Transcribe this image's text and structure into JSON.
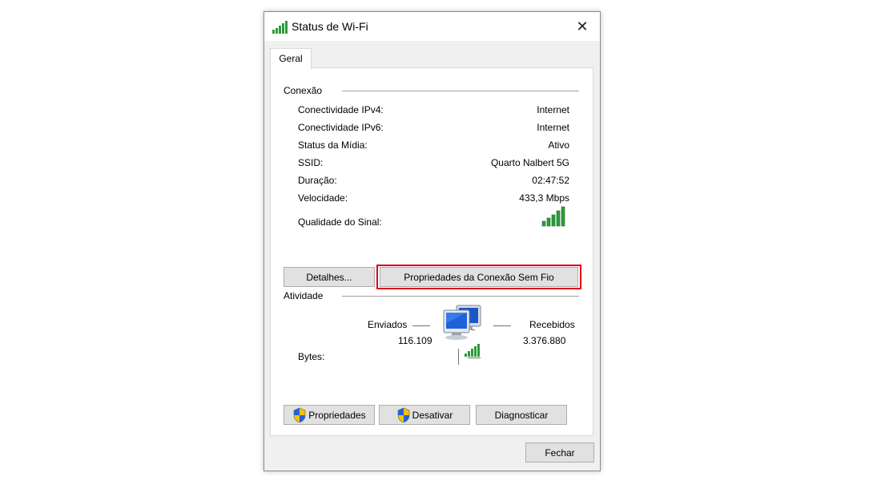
{
  "window": {
    "title": "Status de Wi-Fi",
    "close_glyph": "✕"
  },
  "tabs": [
    {
      "label": "Geral"
    }
  ],
  "connection": {
    "group_label": "Conexão",
    "rows": [
      {
        "label": "Conectividade IPv4:",
        "value": "Internet"
      },
      {
        "label": "Conectividade IPv6:",
        "value": "Internet"
      },
      {
        "label": "Status da Mídia:",
        "value": "Ativo"
      },
      {
        "label": "SSID:",
        "value": "Quarto Nalbert 5G"
      },
      {
        "label": "Duração:",
        "value": "02:47:52"
      },
      {
        "label": "Velocidade:",
        "value": "433,3 Mbps"
      }
    ],
    "signal_label": "Qualidade do Sinal:",
    "signal_icon": "signal-strength-icon",
    "signal_bars": 5,
    "signal_color": "#2e9b3c"
  },
  "connection_buttons": {
    "details": "Detalhes...",
    "wireless_properties": "Propriedades da Conexão Sem Fio",
    "highlight_color": "#e0000b"
  },
  "activity": {
    "group_label": "Atividade",
    "sent_label": "Enviados",
    "received_label": "Recebidos",
    "bytes_label": "Bytes:",
    "sent_value": "116.109",
    "received_value": "3.376.880",
    "icon": "network-computers-icon"
  },
  "action_buttons": {
    "properties": "Propriedades",
    "disable": "Desativar",
    "diagnose": "Diagnosticar",
    "shield_icon": "uac-shield-icon"
  },
  "footer": {
    "close": "Fechar"
  }
}
